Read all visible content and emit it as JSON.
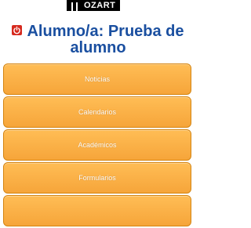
{
  "logo": {
    "text": "OZART"
  },
  "header": {
    "title_line1": "Alumno/a: Prueba de",
    "title_line2": "alumno",
    "logout_icon": "power-icon"
  },
  "menu": {
    "items": [
      {
        "label": "Noticias"
      },
      {
        "label": "Calendarios"
      },
      {
        "label": "Académicos"
      },
      {
        "label": "Formularios"
      },
      {
        "label": ""
      }
    ]
  },
  "colors": {
    "title": "#1a4fa0",
    "button": "#f6a53a",
    "button_border": "#d48410",
    "logout_icon": "#d62a1f"
  }
}
